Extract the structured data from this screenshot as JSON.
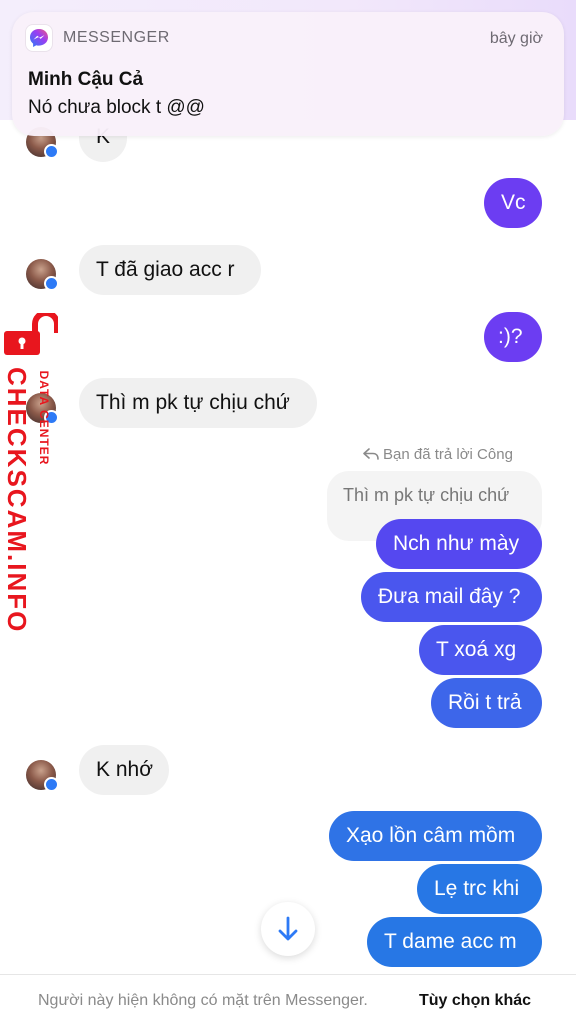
{
  "notification": {
    "app_name": "MESSENGER",
    "time": "bây giờ",
    "sender": "Minh Cậu Cả",
    "body": "Nó chưa block t @@"
  },
  "messages": [
    {
      "dir": "in",
      "text": "K"
    },
    {
      "dir": "out",
      "text": "Vc"
    },
    {
      "dir": "in",
      "text": "T đã giao acc r"
    },
    {
      "dir": "out",
      "text": ":)?"
    },
    {
      "dir": "in",
      "text": "Thì m pk tự chịu chứ"
    },
    {
      "dir": "out",
      "text": "Nch như mày"
    },
    {
      "dir": "out",
      "text": "Đưa mail đây ?"
    },
    {
      "dir": "out",
      "text": "T  xoá xg"
    },
    {
      "dir": "out",
      "text": "Rồi t trả"
    },
    {
      "dir": "in",
      "text": "K nhớ"
    },
    {
      "dir": "out",
      "text": "Xạo lồn câm mồm"
    },
    {
      "dir": "out",
      "text": "Lẹ trc khi"
    },
    {
      "dir": "out",
      "text": "T dame acc m"
    }
  ],
  "reply": {
    "note": "Bạn đã trả lời Công",
    "quoted": "Thì m pk tự chịu chứ"
  },
  "footer": {
    "notice": "Người này hiện không có mặt trên Messenger.",
    "action": "Tùy chọn khác"
  },
  "watermark": {
    "main": "CHECKSCAM.INFO",
    "sub": "DATA CENTER"
  },
  "colors": {
    "outgoing_top": "#6c3df2",
    "outgoing_bottom": "#2777e5",
    "incoming": "#f0f0f0",
    "watermark": "#e8161e"
  }
}
